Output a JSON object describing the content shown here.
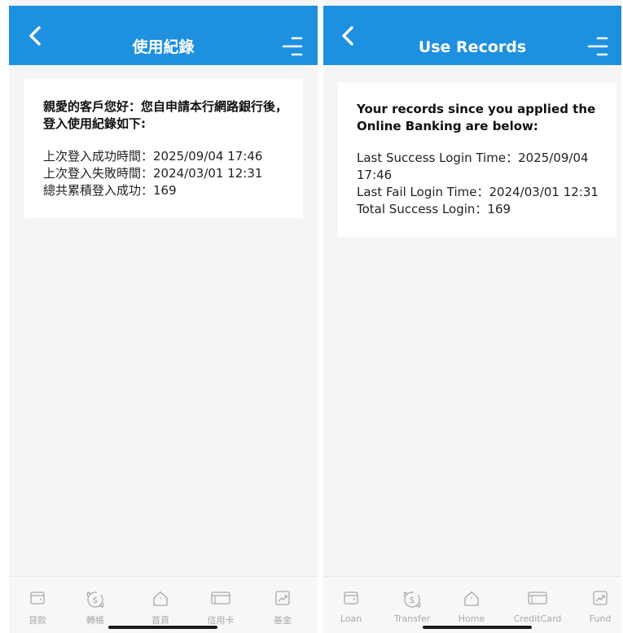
{
  "colors": {
    "header": "#1e90e0",
    "background": "#f5f5f6",
    "card": "#ffffff",
    "tab_icon": "#a9a9a9"
  },
  "zh": {
    "title": "使用紀錄",
    "greeting": "親愛的客戶您好：您自申請本行網路銀行後，登入使用紀錄如下:",
    "lines": [
      "上次登入成功時間：2025/09/04 17:46",
      "上次登入失敗時間：2024/03/01 12:31",
      "總共累積登入成功：169"
    ],
    "tabs": [
      {
        "label": "貸款",
        "icon": "wallet-icon"
      },
      {
        "label": "轉帳",
        "icon": "transfer-icon"
      },
      {
        "label": "首頁",
        "icon": "home-icon"
      },
      {
        "label": "信用卡",
        "icon": "credit-card-icon"
      },
      {
        "label": "基金",
        "icon": "fund-icon"
      }
    ]
  },
  "en": {
    "title": "Use Records",
    "greeting": "Your records since you applied the Online Banking are below:",
    "lines": [
      "Last Success Login Time：2025/09/04 17:46",
      "Last Fail Login Time：2024/03/01 12:31",
      "Total Success Login：169"
    ],
    "tabs": [
      {
        "label": "Loan",
        "icon": "wallet-icon"
      },
      {
        "label": "Transfer",
        "icon": "transfer-icon"
      },
      {
        "label": "Home",
        "icon": "home-icon"
      },
      {
        "label": "CreditCard",
        "icon": "credit-card-icon"
      },
      {
        "label": "Fund",
        "icon": "fund-icon"
      }
    ]
  }
}
